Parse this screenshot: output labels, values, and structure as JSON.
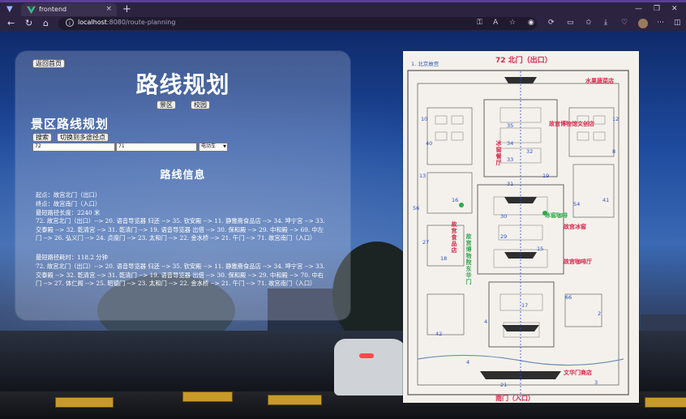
{
  "browser": {
    "tab_title": "frontend",
    "url_host": "localhost",
    "url_path": ":8080/route-planning",
    "new_tab": "+",
    "tab_close": "×"
  },
  "page": {
    "back_button": "返回首页",
    "title": "路线规划",
    "mode_buttons": [
      "景区",
      "校园"
    ],
    "section_title": "景区路线规划",
    "search_button": "搜索",
    "multi_point_button": "切换到多途径点",
    "start_input": "72",
    "end_input": "71",
    "transport_select": "电动车",
    "info_title": "路线信息",
    "start_line": "起点：故宫北门（出口）",
    "end_line": "终点：故宫南门（入口）",
    "shortest_distance": "最短路径长度：2240 米",
    "route_distance": "72. 故宫北门（出口）--> 20. 语音导览器 归还 --> 35. 钦安殿 --> 11. 静雅斋食品店 --> 34. 坤宁宫 --> 33. 交泰殿 --> 32. 乾清宫 --> 31. 乾清门 --> 19. 语音导览器 出借 --> 30. 保和殿 --> 29. 中和殿 --> 69. 中左门 --> 26. 弘义门 --> 24. 贞度门 --> 23. 太和门 --> 22. 金水桥 --> 21. 午门 --> 71. 故宫南门（入口）",
    "shortest_time": "最短路径耗时：118.2 分钟",
    "route_time": "72. 故宫北门（出口）--> 20. 语音导览器 归还 --> 35. 钦安殿 --> 11. 静雅斋食品店 --> 34. 坤宁宫 --> 33. 交泰殿 --> 32. 乾清宫 --> 31. 乾清门 --> 19. 语音导览器 出借 --> 30. 保和殿 --> 29. 中和殿 --> 70. 中右门 --> 27. 体仁阁 --> 25. 昭德门 --> 23. 太和门 --> 22. 金水桥 --> 21. 午门 --> 71. 故宫南门（入口）"
  },
  "map": {
    "header": "1. 北京故宫",
    "top_mark": "72 北门（出口）",
    "bottom_mark": "南门（入口）",
    "red_labels": [
      "水果蔬菜店",
      "故宫博物馆文创店",
      "冰窖餐厅",
      "故宫冰窖",
      "冰窖咖啡",
      "故宫咖啡厅",
      "文华门商店",
      "故宫食品店",
      "故宫博物院东华门"
    ],
    "pencil_numbers": [
      "13",
      "16",
      "27",
      "18",
      "15",
      "42",
      "4",
      "17",
      "33",
      "34",
      "35",
      "29",
      "30",
      "31",
      "40",
      "56",
      "54",
      "41",
      "66",
      "19",
      "32",
      "2",
      "21",
      "4",
      "3",
      "10",
      "8",
      "12"
    ]
  },
  "colors": {
    "panel_glass": "rgba(200,210,230,0.28)",
    "map_red": "#d9264a",
    "map_blue": "#2b52c8",
    "map_green": "#2fa84d",
    "chrome": "#2b2340"
  }
}
